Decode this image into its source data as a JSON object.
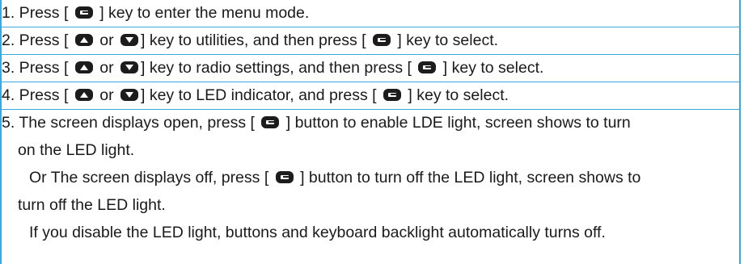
{
  "steps": [
    {
      "num": "1.",
      "a": " Press [",
      "b": "] key to enter the menu mode."
    },
    {
      "num": "2.",
      "a": " Press [",
      "or": "or",
      "b": "] key to utilities, and then press [",
      "c": "] key to select."
    },
    {
      "num": "3.",
      "a": " Press [",
      "or": "or",
      "b": "] key to radio settings, and then press [",
      "c": "] key to select."
    },
    {
      "num": "4.",
      "a": " Press [",
      "or": "or",
      "b": "] key to LED indicator, and press [",
      "c": "] key to select."
    },
    {
      "num": "5.",
      "a": " The screen displays open, press [",
      "b": "] button to enable LDE light, screen shows to turn",
      "cont": "on the LED light."
    }
  ],
  "note1": {
    "a": "Or The screen displays off, press [",
    "b": "] button to turn off the LED light, screen shows to",
    "cont": "turn off the LED light."
  },
  "note2": "If you disable the LED light, buttons and keyboard backlight automatically turns off.",
  "icons": {
    "menu_key": "menu-ok-key-icon",
    "up_key": "up-arrow-key-icon",
    "down_key": "down-arrow-key-icon"
  },
  "colors": {
    "border": "#39a9e0",
    "key": "#1c1c1c"
  }
}
